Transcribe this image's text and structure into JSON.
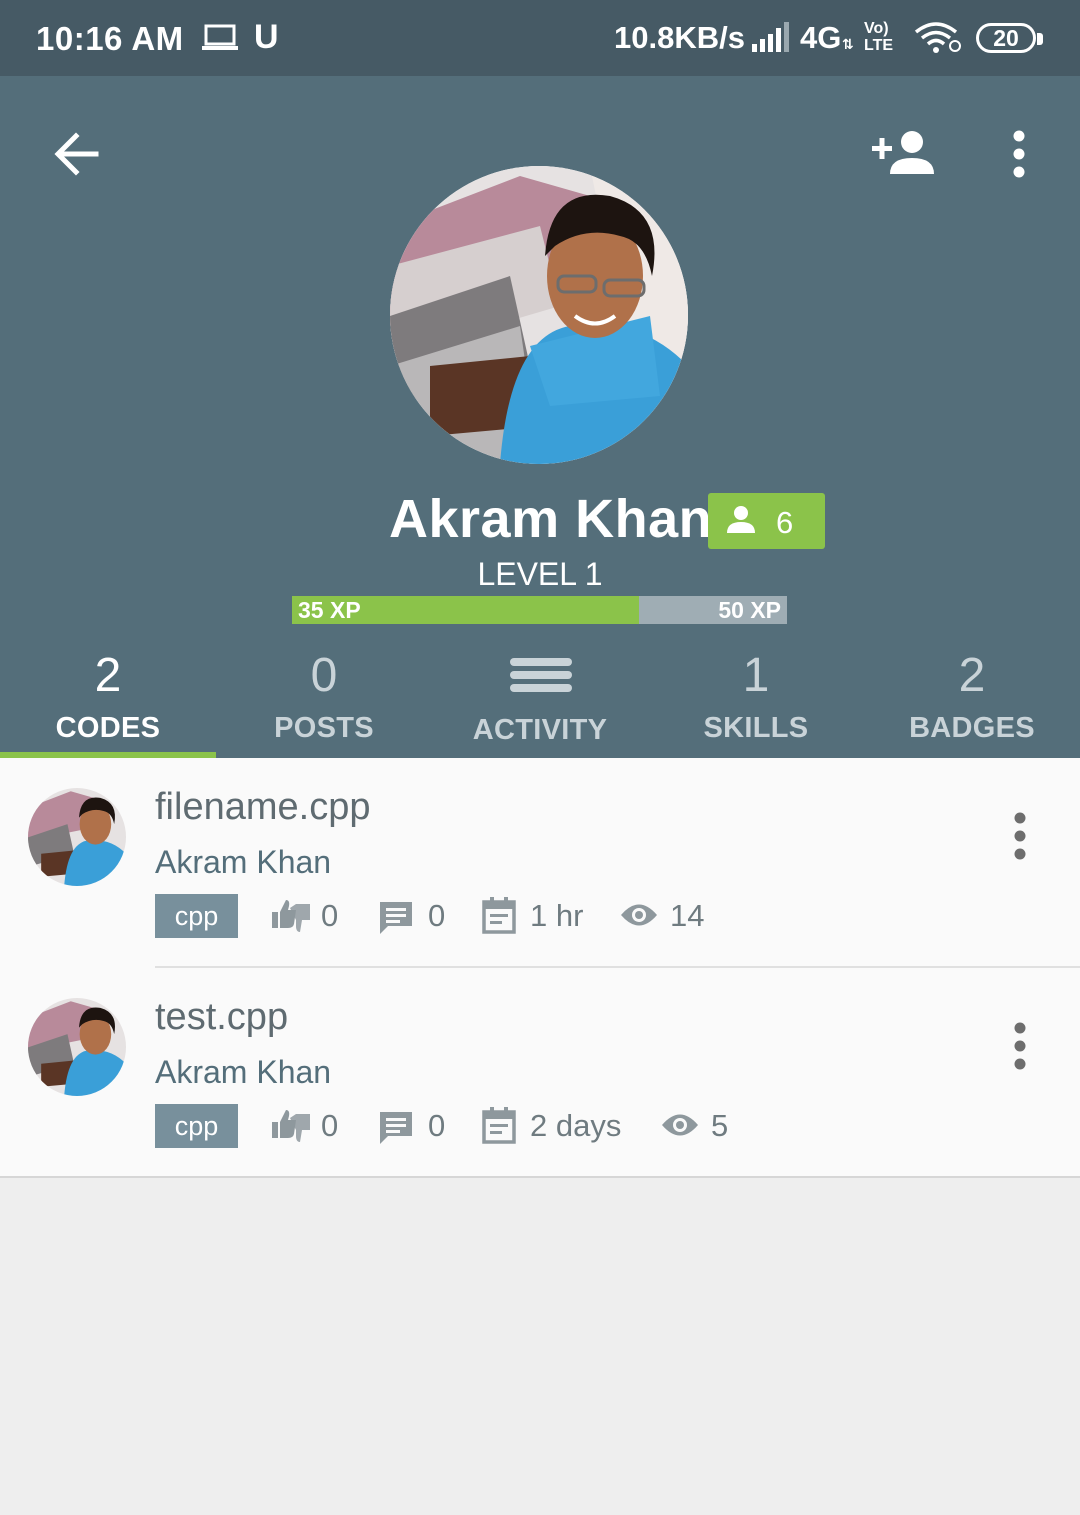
{
  "status_bar": {
    "time": "10:16 AM",
    "u_indicator": "U",
    "net_speed": "10.8KB/s",
    "network": "4G",
    "volte_line1": "Vo)",
    "volte_line2": "LTE",
    "battery": "20"
  },
  "profile": {
    "name": "Akram Khan",
    "followers": "6",
    "level": "LEVEL 1",
    "xp_current": "35 XP",
    "xp_target": "50 XP",
    "xp_progress": 0.7
  },
  "tabs": [
    {
      "count": "2",
      "label": "CODES",
      "active": true
    },
    {
      "count": "0",
      "label": "POSTS",
      "active": false
    },
    {
      "count": "",
      "label": "ACTIVITY",
      "active": false
    },
    {
      "count": "1",
      "label": "SKILLS",
      "active": false
    },
    {
      "count": "2",
      "label": "BADGES",
      "active": false
    }
  ],
  "codes": [
    {
      "filename": "filename.cpp",
      "author": "Akram Khan",
      "language": "cpp",
      "votes": "0",
      "comments": "0",
      "date": "1 hr",
      "views": "14"
    },
    {
      "filename": "test.cpp",
      "author": "Akram Khan",
      "language": "cpp",
      "votes": "0",
      "comments": "0",
      "date": "2 days",
      "views": "5"
    }
  ],
  "colors": {
    "status_bar": "#465a65",
    "header": "#546e7a",
    "accent": "#8bc34a",
    "lang_tag": "#78909c"
  },
  "icons": [
    "back-arrow-icon",
    "add-friend-icon",
    "more-vert-icon",
    "person-icon",
    "menu-icon",
    "thumbs-icon",
    "comment-icon",
    "calendar-icon",
    "eye-icon"
  ]
}
